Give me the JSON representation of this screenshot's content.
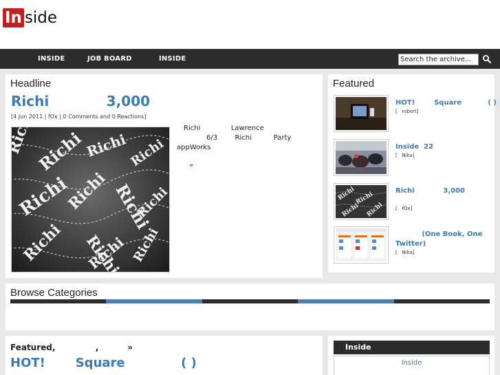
{
  "site": {
    "logo_in": "In",
    "logo_rest": "side"
  },
  "nav": {
    "items": [
      "INSIDE",
      "JOB BOARD",
      "INSIDE"
    ],
    "search_placeholder": "Search the archive..."
  },
  "headline": {
    "section_title": "Headline",
    "title": "Richi            3,000",
    "meta": "[4 Jun 2011 |     fOx | 0 Comments and 0 Reactions]",
    "image_word": "Richi",
    "body_lines": [
      "Richi              Lawrence",
      "6/3        Richi          Party",
      "appWorks"
    ],
    "more": "»"
  },
  "featured": {
    "section_title": "Featured",
    "items": [
      {
        "title": "HOT!        Square           ( )",
        "title2": "",
        "meta": "[   robert]"
      },
      {
        "title": "Inside  22",
        "title2": "",
        "meta": "[   Nika]"
      },
      {
        "title": "Richi            3,000",
        "title2": "",
        "meta": "[   fOx]"
      },
      {
        "title": "           (One Book, One",
        "title2": "Twitter)",
        "meta": "[   Nika]"
      }
    ]
  },
  "browse": {
    "section_title": "Browse Categories"
  },
  "featured2": {
    "title": "Featured,              ,          »",
    "headline": "HOT!       Square             ( )"
  },
  "sidebar": {
    "header": "Inside",
    "link": "Inside"
  },
  "colors": {
    "accent": "#3a7ab8",
    "dark": "#2c2c2c",
    "logo_red": "#c41f1f",
    "blue_bar": "#4a80b4"
  }
}
